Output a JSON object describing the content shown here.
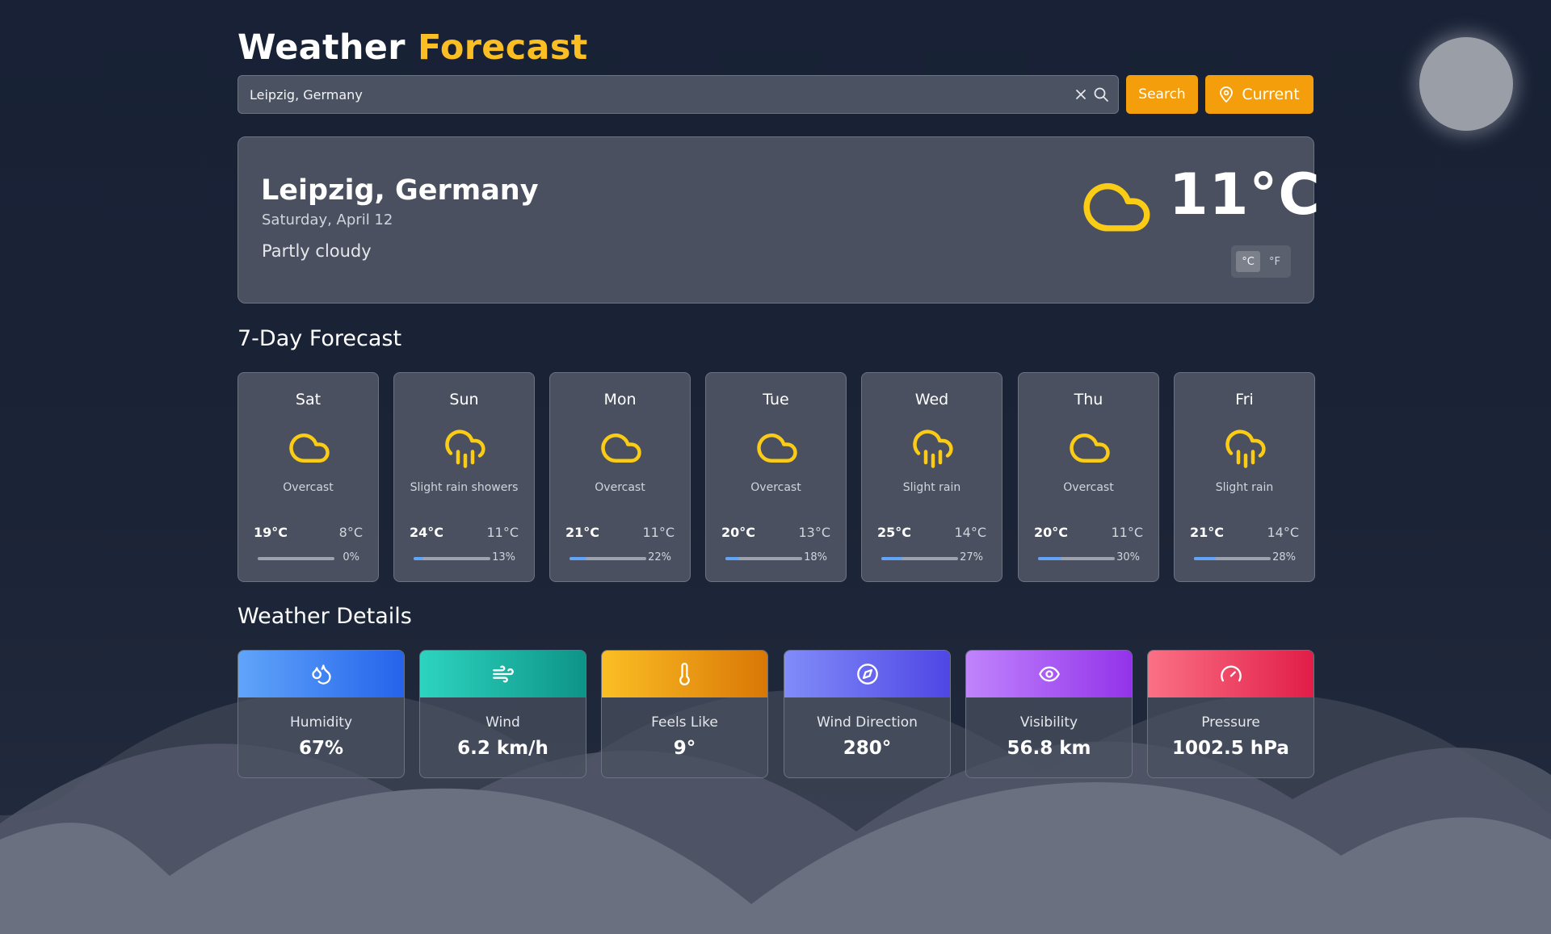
{
  "app": {
    "title_main": "Weather",
    "title_accent": "Forecast"
  },
  "search": {
    "value": "Leipzig, Germany",
    "search_button": "Search",
    "current_button": "Current"
  },
  "current": {
    "city": "Leipzig, Germany",
    "date": "Saturday, April 12",
    "condition": "Partly cloudy",
    "temperature": "11°C",
    "icon": "cloud-icon",
    "unit_celsius": "°C",
    "unit_fahrenheit": "°F",
    "selected_unit": "°C"
  },
  "forecast": {
    "title": "7-Day Forecast",
    "days": [
      {
        "day": "Sat",
        "condition": "Overcast",
        "icon": "cloud-icon",
        "high": "19°C",
        "low": "8°C",
        "rain": "0%",
        "rain_fraction": 0
      },
      {
        "day": "Sun",
        "condition": "Slight rain showers",
        "icon": "rain-icon",
        "high": "24°C",
        "low": "11°C",
        "rain": "13%",
        "rain_fraction": 0.13
      },
      {
        "day": "Mon",
        "condition": "Overcast",
        "icon": "cloud-icon",
        "high": "21°C",
        "low": "11°C",
        "rain": "22%",
        "rain_fraction": 0.22
      },
      {
        "day": "Tue",
        "condition": "Overcast",
        "icon": "cloud-icon",
        "high": "20°C",
        "low": "13°C",
        "rain": "18%",
        "rain_fraction": 0.18
      },
      {
        "day": "Wed",
        "condition": "Slight rain",
        "icon": "rain-icon",
        "high": "25°C",
        "low": "14°C",
        "rain": "27%",
        "rain_fraction": 0.27
      },
      {
        "day": "Thu",
        "condition": "Overcast",
        "icon": "cloud-icon",
        "high": "20°C",
        "low": "11°C",
        "rain": "30%",
        "rain_fraction": 0.3
      },
      {
        "day": "Fri",
        "condition": "Slight rain",
        "icon": "rain-icon",
        "high": "21°C",
        "low": "14°C",
        "rain": "28%",
        "rain_fraction": 0.28
      }
    ]
  },
  "details": {
    "title": "Weather Details",
    "items": [
      {
        "label": "Humidity",
        "value": "67%",
        "icon": "droplets-icon",
        "gradient": [
          "#60a5fa",
          "#2563eb"
        ]
      },
      {
        "label": "Wind",
        "value": "6.2 km/h",
        "icon": "wind-icon",
        "gradient": [
          "#2dd4bf",
          "#0d9488"
        ]
      },
      {
        "label": "Feels Like",
        "value": "9°",
        "icon": "thermometer-icon",
        "gradient": [
          "#fbbf24",
          "#d97706"
        ]
      },
      {
        "label": "Wind Direction",
        "value": "280°",
        "icon": "compass-icon",
        "gradient": [
          "#818cf8",
          "#4f46e5"
        ]
      },
      {
        "label": "Visibility",
        "value": "56.8 km",
        "icon": "eye-icon",
        "gradient": [
          "#c084fc",
          "#9333ea"
        ]
      },
      {
        "label": "Pressure",
        "value": "1002.5 hPa",
        "icon": "gauge-icon",
        "gradient": [
          "#fb7185",
          "#e11d48"
        ]
      }
    ]
  },
  "colors": {
    "accent": "#fbbf24",
    "button": "#f59e0b",
    "icon_yellow": "#facc15",
    "rain_bar": "#60a5fa"
  }
}
